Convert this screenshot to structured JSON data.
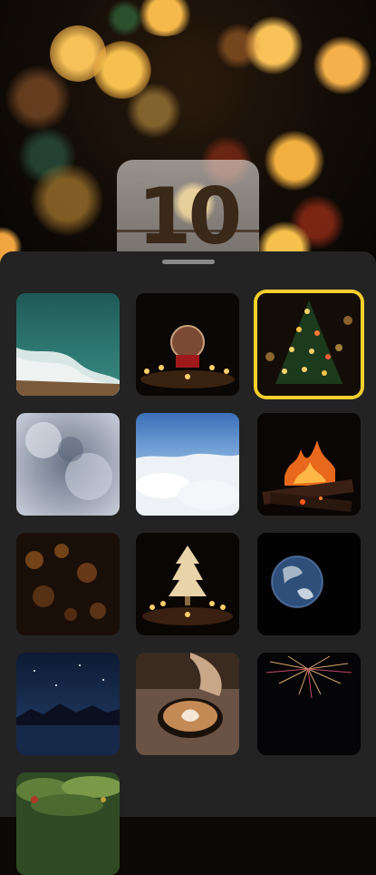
{
  "clock": {
    "digits": "10"
  },
  "wallpapers": [
    {
      "name": "ocean-waves-thumbnail",
      "selected": false
    },
    {
      "name": "snow-globe-candles-thumbnail",
      "selected": false
    },
    {
      "name": "christmas-tree-lights-thumbnail",
      "selected": true
    },
    {
      "name": "frosted-window-thumbnail",
      "selected": false
    },
    {
      "name": "clouds-sky-thumbnail",
      "selected": false
    },
    {
      "name": "fireplace-thumbnail",
      "selected": false
    },
    {
      "name": "rain-glass-thumbnail",
      "selected": false
    },
    {
      "name": "candle-tree-thumbnail",
      "selected": false
    },
    {
      "name": "earth-planet-thumbnail",
      "selected": false
    },
    {
      "name": "night-lake-thumbnail",
      "selected": false
    },
    {
      "name": "latte-art-thumbnail",
      "selected": false
    },
    {
      "name": "fireworks-thumbnail",
      "selected": false
    },
    {
      "name": "mossy-forest-thumbnail",
      "selected": false
    }
  ],
  "colors": {
    "selection": "#f2cf2d",
    "sheet": "#232323"
  }
}
